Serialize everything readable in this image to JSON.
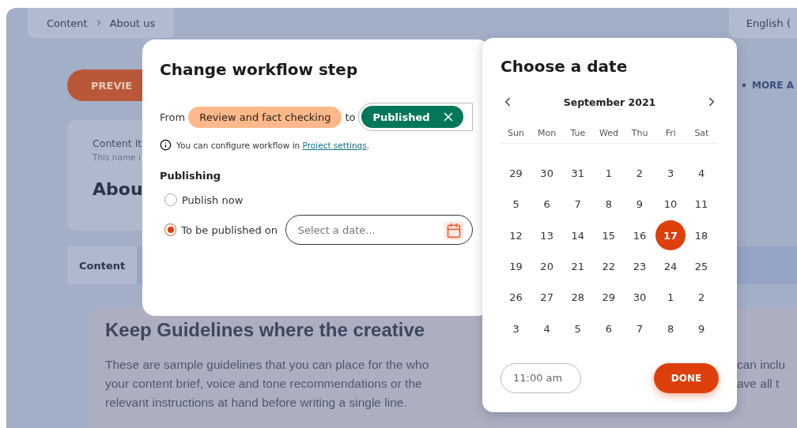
{
  "breadcrumb": [
    "Content",
    "About us"
  ],
  "language": "English (",
  "preview_button": "PREVIE",
  "more_actions": "MORE A",
  "content_card": {
    "label": "Content It",
    "hint": "This name i",
    "title": "Abou"
  },
  "tabs": [
    {
      "label": "Content",
      "selected": true
    }
  ],
  "guidelines": {
    "heading": "Keep Guidelines where the creative",
    "lines": [
      {
        "left": "These are sample guidelines that you can place for the who",
        "right": "can inclu"
      },
      {
        "left": "your content brief, voice and tone recommendations or the",
        "right": "ave all t"
      },
      {
        "left": "relevant instructions at hand before writing a single line."
      }
    ]
  },
  "workflow_dialog": {
    "title": "Change workflow step",
    "from_label": "From",
    "from_step": "Review and fact checking",
    "to_label": "to",
    "to_step": "Published",
    "info_text": "You can configure workflow in",
    "info_link": "Project settings",
    "info_end": ".",
    "publishing_heading": "Publishing",
    "options": [
      {
        "label": "Publish now",
        "selected": false
      },
      {
        "label": "To be published on",
        "selected": true
      }
    ],
    "date_field": {
      "placeholder": "Select a date..."
    }
  },
  "date_picker": {
    "title": "Choose a date",
    "month": "September 2021",
    "weekdays": [
      "Sun",
      "Mon",
      "Tue",
      "Wed",
      "Thu",
      "Fri",
      "Sat"
    ],
    "weeks": [
      [
        {
          "day": "29",
          "selected": false
        },
        {
          "day": "30",
          "selected": false
        },
        {
          "day": "31",
          "selected": false
        },
        {
          "day": "1",
          "selected": false
        },
        {
          "day": "2",
          "selected": false
        },
        {
          "day": "3",
          "selected": false
        },
        {
          "day": "4",
          "selected": false
        }
      ],
      [
        {
          "day": "5",
          "selected": false
        },
        {
          "day": "6",
          "selected": false
        },
        {
          "day": "7",
          "selected": false
        },
        {
          "day": "8",
          "selected": false
        },
        {
          "day": "9",
          "selected": false
        },
        {
          "day": "10",
          "selected": false
        },
        {
          "day": "11",
          "selected": false
        }
      ],
      [
        {
          "day": "12",
          "selected": false
        },
        {
          "day": "13",
          "selected": false
        },
        {
          "day": "14",
          "selected": false
        },
        {
          "day": "15",
          "selected": false
        },
        {
          "day": "16",
          "selected": false
        },
        {
          "day": "17",
          "selected": true
        },
        {
          "day": "18",
          "selected": false
        }
      ],
      [
        {
          "day": "19",
          "selected": false
        },
        {
          "day": "20",
          "selected": false
        },
        {
          "day": "21",
          "selected": false
        },
        {
          "day": "22",
          "selected": false
        },
        {
          "day": "23",
          "selected": false
        },
        {
          "day": "24",
          "selected": false
        },
        {
          "day": "25",
          "selected": false
        }
      ],
      [
        {
          "day": "26",
          "selected": false
        },
        {
          "day": "27",
          "selected": false
        },
        {
          "day": "28",
          "selected": false
        },
        {
          "day": "29",
          "selected": false
        },
        {
          "day": "30",
          "selected": false
        },
        {
          "day": "1",
          "selected": false
        },
        {
          "day": "2",
          "selected": false
        }
      ],
      [
        {
          "day": "3",
          "selected": false
        },
        {
          "day": "4",
          "selected": false
        },
        {
          "day": "5",
          "selected": false
        },
        {
          "day": "6",
          "selected": false
        },
        {
          "day": "7",
          "selected": false
        },
        {
          "day": "8",
          "selected": false
        },
        {
          "day": "9",
          "selected": false
        }
      ]
    ],
    "time": "11:00 am",
    "done_button": "DONE"
  }
}
